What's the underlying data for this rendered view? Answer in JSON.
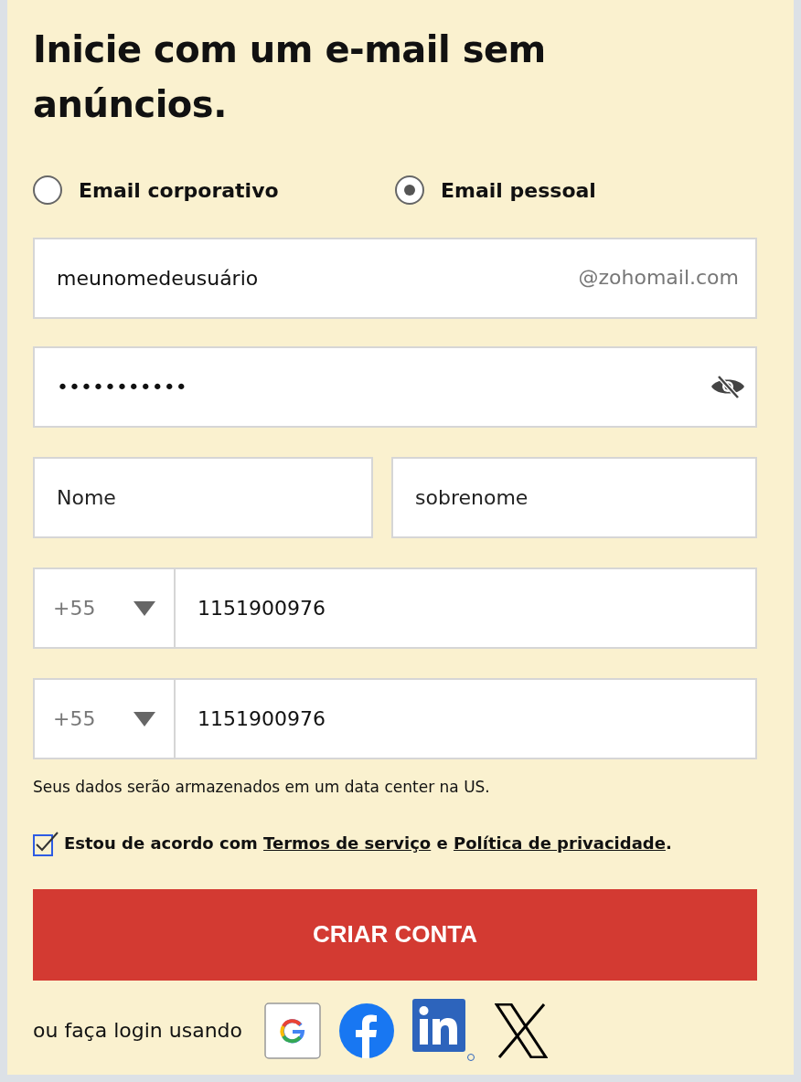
{
  "title": "Inicie com um e-mail sem anúncios.",
  "account_types": [
    {
      "label": "Email corporativo",
      "selected": false
    },
    {
      "label": "Email pessoal",
      "selected": true
    }
  ],
  "username": {
    "value": "meunomedeusuário",
    "suffix": "@zohomail.com"
  },
  "password": {
    "value": "•••••••••••"
  },
  "first_name": {
    "placeholder": "Nome"
  },
  "last_name": {
    "placeholder": "sobrenome"
  },
  "phones": [
    {
      "country_code": "+55",
      "number": "1151900976"
    },
    {
      "country_code": "+55",
      "number": "1151900976"
    }
  ],
  "data_notice": "Seus dados serão armazenados em um data center na US.",
  "agreement": {
    "checked": true,
    "text_before": "Estou de acordo com",
    "terms_link": "Termos de serviço",
    "conjunction": "e",
    "privacy_link": "Política de privacidade",
    "text_after": "."
  },
  "submit_button": "CRIAR CONTA",
  "social_login": {
    "label": "ou faça login usando"
  }
}
